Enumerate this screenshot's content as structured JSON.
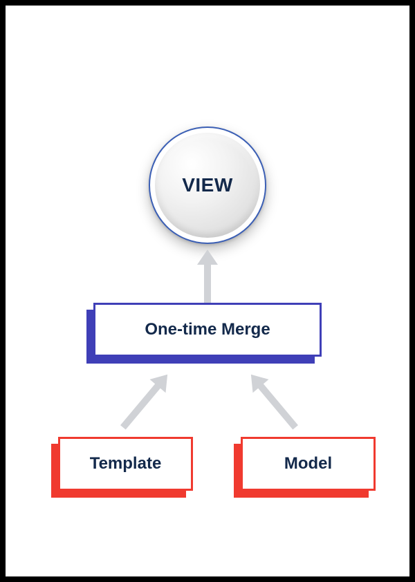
{
  "nodes": {
    "view": {
      "label": "VIEW"
    },
    "merge": {
      "label": "One-time Merge"
    },
    "template": {
      "label": "Template"
    },
    "model": {
      "label": "Model"
    }
  },
  "colors": {
    "navy_text": "#13294b",
    "blue_border": "#3f3fb7",
    "red_border": "#f03a2f",
    "arrow": "#d0d2d6",
    "circle_border": "#3b5fb5"
  },
  "edges": [
    {
      "from": "template",
      "to": "merge"
    },
    {
      "from": "model",
      "to": "merge"
    },
    {
      "from": "merge",
      "to": "view"
    }
  ]
}
